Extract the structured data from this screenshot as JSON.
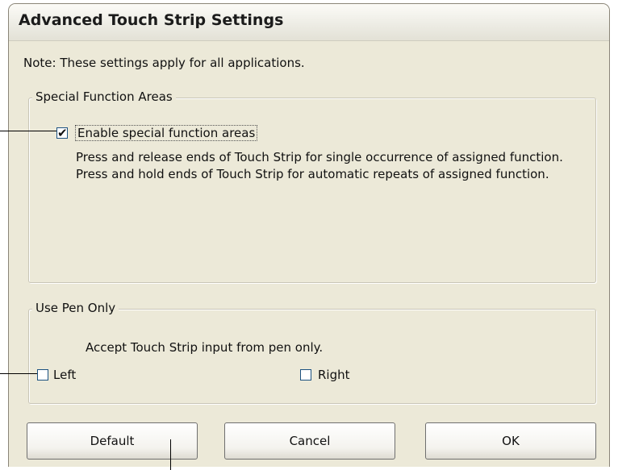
{
  "dialog": {
    "title": "Advanced Touch Strip Settings",
    "note": "Note: These settings apply for all applications."
  },
  "special_function_areas": {
    "legend": "Special Function Areas",
    "checkbox_label": "Enable special function areas",
    "checked": true,
    "description": "Press and release ends of Touch Strip for single occurrence of assigned function. Press and hold ends of Touch Strip for automatic repeats of assigned function."
  },
  "use_pen_only": {
    "legend": "Use Pen Only",
    "description": "Accept Touch Strip input from pen only.",
    "left_label": "Left",
    "left_checked": false,
    "right_label": "Right",
    "right_checked": false
  },
  "buttons": {
    "default_label": "Default",
    "cancel_label": "Cancel",
    "ok_label": "OK"
  },
  "icons": {
    "checkmark": "check-icon"
  }
}
